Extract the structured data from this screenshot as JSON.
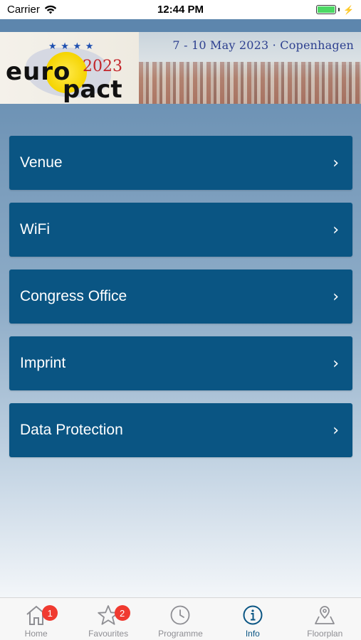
{
  "status_bar": {
    "carrier": "Carrier",
    "time": "12:44 PM"
  },
  "banner": {
    "dates": "7 - 10 May 2023 · Copenhagen",
    "logo_euro": "euro",
    "logo_year": "2023",
    "logo_pact": "pact",
    "logo_stars": "★ ★ ★ ★"
  },
  "menu": {
    "items": [
      {
        "label": "Venue"
      },
      {
        "label": "WiFi"
      },
      {
        "label": "Congress Office"
      },
      {
        "label": "Imprint"
      },
      {
        "label": "Data Protection"
      }
    ],
    "chevron": "›"
  },
  "tab_bar": {
    "tabs": [
      {
        "label": "Home",
        "icon": "home-icon",
        "badge": "1"
      },
      {
        "label": "Favourites",
        "icon": "star-icon",
        "badge": "2"
      },
      {
        "label": "Programme",
        "icon": "clock-icon"
      },
      {
        "label": "Info",
        "icon": "info-icon",
        "active": true
      },
      {
        "label": "Floorplan",
        "icon": "map-pin-icon"
      }
    ]
  },
  "colors": {
    "menu_item_bg": "#0a5583",
    "active_tab": "#0a5583",
    "badge": "#f03a30",
    "battery": "#4cd964"
  }
}
